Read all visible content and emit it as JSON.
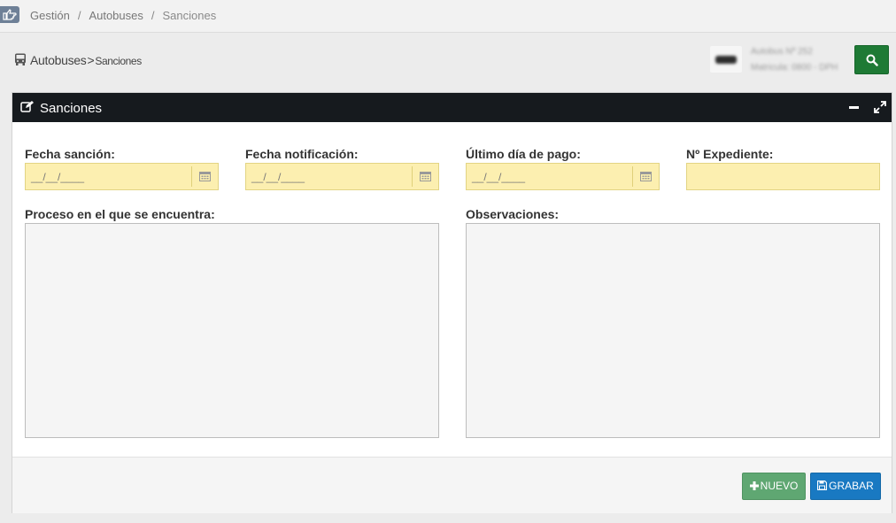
{
  "breadcrumb": {
    "items": [
      "Gestión",
      "Autobuses",
      "Sanciones"
    ],
    "separator": "/"
  },
  "header": {
    "section": "Autobuses",
    "chevron": ">",
    "subsection": "Sanciones"
  },
  "bus_info": {
    "line1": "Autobus Nº 252",
    "line2": "Matricula: 0800 - DPH"
  },
  "panel": {
    "title": "Sanciones"
  },
  "form": {
    "fecha_sancion": {
      "label": "Fecha sanción:",
      "value": "__/__/____"
    },
    "fecha_notificacion": {
      "label": "Fecha notificación:",
      "value": "__/__/____"
    },
    "ultimo_dia_pago": {
      "label": "Último día de pago:",
      "value": "__/__/____"
    },
    "expediente": {
      "label": "Nº Expediente:",
      "value": ""
    },
    "proceso": {
      "label": "Proceso en el que se encuentra:",
      "value": ""
    },
    "observaciones": {
      "label": "Observaciones:",
      "value": ""
    }
  },
  "actions": {
    "new_label": "NUEVO",
    "save_label": "GRABAR"
  },
  "colors": {
    "panel_header": "#161a1e",
    "required_field": "#fcefb0",
    "search_button": "#1e7a35",
    "new_button": "#5fa772",
    "save_button": "#1979c2"
  },
  "icons": [
    "hand-point-icon",
    "bus-icon",
    "search-icon",
    "edit-icon",
    "minimize-icon",
    "expand-icon",
    "calendar-icon",
    "plus-icon",
    "save-icon"
  ]
}
